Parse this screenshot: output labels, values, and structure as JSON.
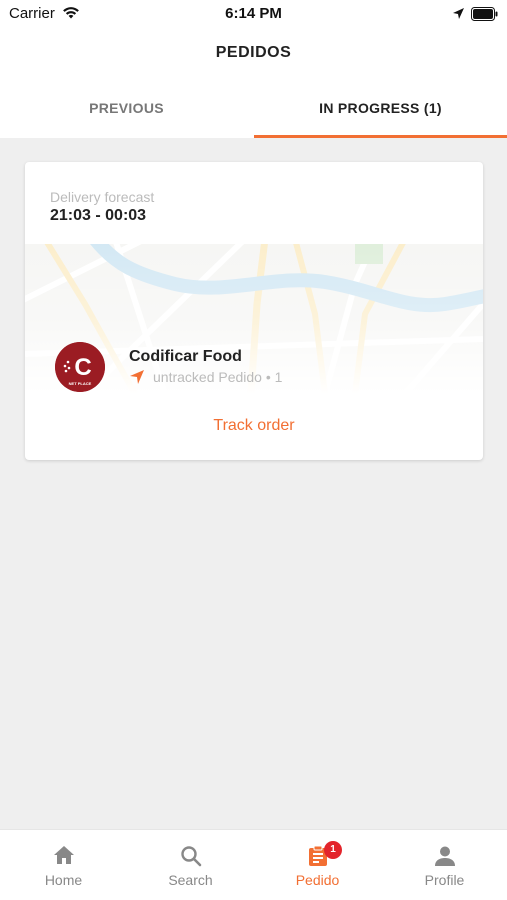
{
  "status_bar": {
    "carrier": "Carrier",
    "time": "6:14 PM",
    "wifi_icon": "wifi-icon",
    "location_icon": "location-arrow-icon",
    "battery_icon": "battery-icon"
  },
  "header": {
    "title": "PEDIDOS"
  },
  "tabs": [
    {
      "label": "PREVIOUS",
      "active": false
    },
    {
      "label": "IN PROGRESS (1)",
      "active": true
    }
  ],
  "order": {
    "forecast_label": "Delivery forecast",
    "forecast_value": "21:03 - 00:03",
    "store_name": "Codificar Food",
    "tracking_status": "untracked Pedido • 1",
    "track_button": "Track order",
    "logo_letter": "C",
    "logo_sub": "NET PLACE",
    "logo_color": "#9b1c23"
  },
  "bottom_nav": [
    {
      "label": "Home",
      "icon": "home-icon",
      "active": false
    },
    {
      "label": "Search",
      "icon": "search-icon",
      "active": false
    },
    {
      "label": "Pedido",
      "icon": "clipboard-icon",
      "active": true,
      "badge": "1"
    },
    {
      "label": "Profile",
      "icon": "person-icon",
      "active": false
    }
  ],
  "colors": {
    "accent": "#f26f33",
    "badge": "#e3242b",
    "background": "#efefef"
  }
}
